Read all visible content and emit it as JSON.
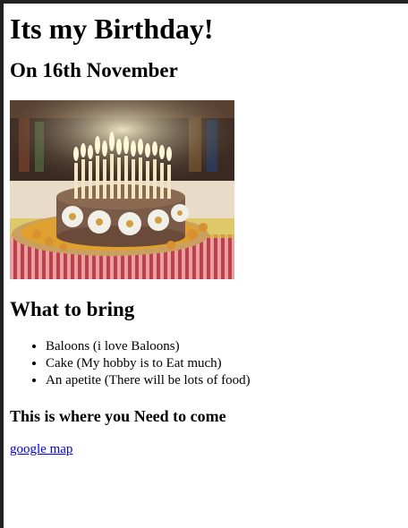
{
  "page": {
    "title": "Its my Birthday!",
    "date_heading": "On 16th November",
    "bring_heading": "What to bring",
    "items": [
      "Baloons (i love Baloons)",
      "Cake (My hobby is to Eat much)",
      "An apetite (There will be lots of food)"
    ],
    "where_heading": "This is where you Need to come",
    "map_link": "google map"
  },
  "image": {
    "icon": "birthday-cake-photo"
  },
  "colors": {
    "link": "#0000ee",
    "frame": "#222222",
    "background": "#ffffff"
  }
}
